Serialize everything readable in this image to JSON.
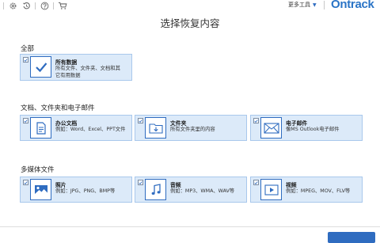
{
  "topbar": {
    "icons": [
      "settings-icon",
      "history-icon",
      "help-icon",
      "cart-icon"
    ],
    "more_tools_label": "更多工具",
    "brand": "Ontrack",
    "brand_color": "#2a74c6"
  },
  "title": "选择恢复内容",
  "sections": {
    "all": {
      "label": "全部",
      "all_data": {
        "title": "所有数据",
        "desc_line1": "所有文件、文件夹、文档和其",
        "desc_line2": "它有用数据",
        "icon": "check-icon"
      }
    },
    "docs": {
      "label": "文档、文件夹和电子邮件",
      "office": {
        "title": "办公文档",
        "desc": "例如：Word、Excel、PPT文件",
        "icon": "document-icon"
      },
      "folder": {
        "title": "文件夹",
        "desc": "所有文件夹里的内容",
        "icon": "folder-icon"
      },
      "email": {
        "title": "电子邮件",
        "desc": "像MS Outlook电子邮件",
        "icon": "envelope-icon"
      }
    },
    "media": {
      "label": "多媒体文件",
      "photos": {
        "title": "照片",
        "desc": "例如：JPG、PNG、BMP等",
        "icon": "image-icon"
      },
      "audio": {
        "title": "音频",
        "desc": "例如：MP3、WMA、WAV等",
        "icon": "music-icon"
      },
      "video": {
        "title": "视频",
        "desc": "例如：MPEG、MOV、FLV等",
        "icon": "play-icon"
      }
    }
  },
  "colors": {
    "accent": "#2f6cc0",
    "card_bg": "#dceaf9",
    "card_border": "#a9c8ec"
  }
}
